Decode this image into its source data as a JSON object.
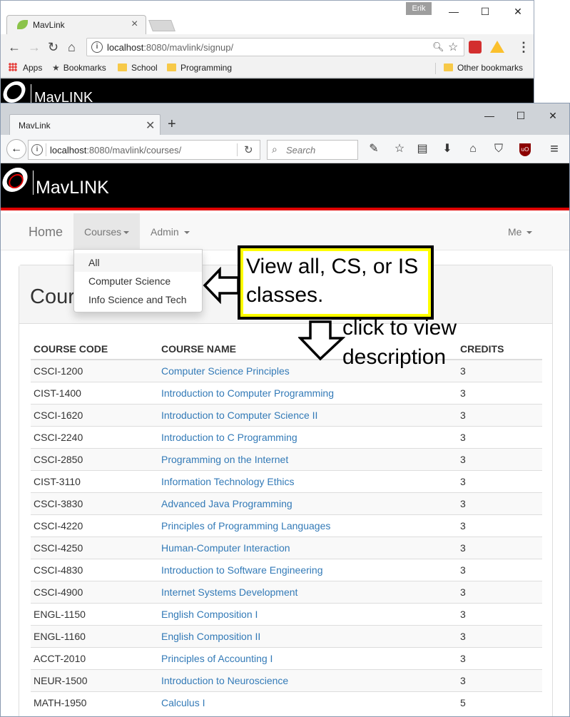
{
  "back_window": {
    "profile_name": "Erik",
    "tab_title": "MavLink",
    "url_host": "localhost",
    "url_path": ":8080/mavlink/signup/",
    "bookmarks": [
      "Apps",
      "Bookmarks",
      "School",
      "Programming"
    ],
    "other_bookmarks": "Other bookmarks",
    "brand": "MavLINK"
  },
  "front_window": {
    "tab_title": "MavLink",
    "url_host": "localhost",
    "url_path": ":8080/mavlink/courses/",
    "search_placeholder": "Search"
  },
  "site": {
    "brand": "MavLINK",
    "nav": {
      "home": "Home",
      "courses": "Courses",
      "admin": "Admin",
      "me": "Me"
    },
    "dropdown": [
      "All",
      "Computer Science",
      "Info Science and Tech"
    ],
    "page_title": "Courses"
  },
  "table": {
    "headers": [
      "COURSE CODE",
      "COURSE NAME",
      "CREDITS"
    ],
    "rows": [
      [
        "CSCI-1200",
        "Computer Science Principles",
        "3"
      ],
      [
        "CIST-1400",
        "Introduction to Computer Programming",
        "3"
      ],
      [
        "CSCI-1620",
        "Introduction to Computer Science II",
        "3"
      ],
      [
        "CSCI-2240",
        "Introduction to C Programming",
        "3"
      ],
      [
        "CSCI-2850",
        "Programming on the Internet",
        "3"
      ],
      [
        "CIST-3110",
        "Information Technology Ethics",
        "3"
      ],
      [
        "CSCI-3830",
        "Advanced Java Programming",
        "3"
      ],
      [
        "CSCI-4220",
        "Principles of Programming Languages",
        "3"
      ],
      [
        "CSCI-4250",
        "Human-Computer Interaction",
        "3"
      ],
      [
        "CSCI-4830",
        "Introduction to Software Engineering",
        "3"
      ],
      [
        "CSCI-4900",
        "Internet Systems Development",
        "3"
      ],
      [
        "ENGL-1150",
        "English Composition I",
        "3"
      ],
      [
        "ENGL-1160",
        "English Composition II",
        "3"
      ],
      [
        "ACCT-2010",
        "Principles of Accounting I",
        "3"
      ],
      [
        "NEUR-1500",
        "Introduction to Neuroscience",
        "3"
      ],
      [
        "MATH-1950",
        "Calculus I",
        "5"
      ]
    ]
  },
  "annotations": {
    "callout": "View all, CS, or IS classes.",
    "hint_line1": "click to view",
    "hint_line2": "description"
  },
  "colors": {
    "accent_red": "#e00000",
    "link_blue": "#337ab7",
    "callout_yellow": "#ffff00"
  }
}
